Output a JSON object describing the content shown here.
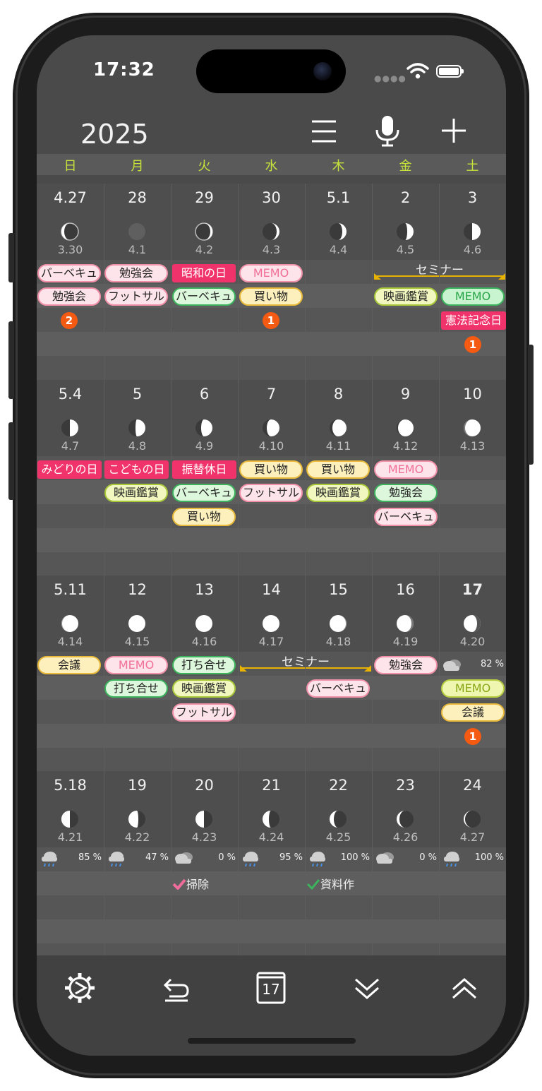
{
  "status": {
    "time": "17:32"
  },
  "header": {
    "year": "2025",
    "icons": [
      "menu-icon",
      "microphone-icon",
      "plus-icon"
    ]
  },
  "weekdays": [
    "日",
    "月",
    "火",
    "水",
    "木",
    "金",
    "土"
  ],
  "weeks": [
    {
      "dates": [
        "4.27",
        "28",
        "29",
        "30",
        "5.1",
        "2",
        "3"
      ],
      "lunar": [
        "3.30",
        "4.1",
        "4.2",
        "4.3",
        "4.4",
        "4.5",
        "4.6"
      ],
      "span": {
        "label": "セミナー"
      },
      "events": [
        [
          "バーベキュ",
          "勉強会"
        ],
        [
          "勉強会",
          "フットサル"
        ],
        [
          "昭和の日",
          "バーベキュ"
        ],
        [
          "MEMO",
          "買い物"
        ],
        [],
        [
          "映画鑑賞"
        ],
        [
          "MEMO",
          "憲法記念日"
        ]
      ],
      "badges": [
        "2",
        "",
        "",
        "1",
        "",
        "",
        "1"
      ]
    },
    {
      "dates": [
        "5.4",
        "5",
        "6",
        "7",
        "8",
        "9",
        "10"
      ],
      "lunar": [
        "4.7",
        "4.8",
        "4.9",
        "4.10",
        "4.11",
        "4.12",
        "4.13"
      ],
      "events": [
        [
          "みどりの日"
        ],
        [
          "こどもの日",
          "映画鑑賞"
        ],
        [
          "振替休日",
          "バーベキュ",
          "買い物"
        ],
        [
          "買い物",
          "フットサル"
        ],
        [
          "買い物",
          "映画鑑賞"
        ],
        [
          "MEMO",
          "勉強会",
          "バーベキュ"
        ],
        []
      ]
    },
    {
      "dates": [
        "5.11",
        "12",
        "13",
        "14",
        "15",
        "16",
        "17"
      ],
      "lunar": [
        "4.14",
        "4.15",
        "4.16",
        "4.17",
        "4.18",
        "4.19",
        "4.20"
      ],
      "span": {
        "label": "セミナー"
      },
      "events": [
        [
          "会議"
        ],
        [
          "MEMO",
          "打ち合せ"
        ],
        [
          "打ち合せ",
          "映画鑑賞",
          "フットサル"
        ],
        [],
        [
          "バーベキュ"
        ],
        [
          "勉強会"
        ],
        [
          "MEMO",
          "会議"
        ]
      ],
      "weather_today": "82 %",
      "badge_sat": "1"
    },
    {
      "dates": [
        "5.18",
        "19",
        "20",
        "21",
        "22",
        "23",
        "24"
      ],
      "lunar": [
        "4.21",
        "4.22",
        "4.23",
        "4.24",
        "4.25",
        "4.26",
        "4.27"
      ],
      "weather": [
        "85 %",
        "47 %",
        "0 %",
        "95 %",
        "100 %",
        "0 %",
        "100 %"
      ],
      "tasks": [
        "掃除",
        "資料作"
      ]
    }
  ],
  "tabbar": {
    "icons": [
      "settings-icon",
      "undo-icon",
      "today-icon",
      "scroll-down-icon",
      "scroll-up-icon"
    ],
    "today_number": "17"
  },
  "colors": {
    "holiday": "#f0336a",
    "badge": "#f55a12",
    "weekday_header": "#c6e33b",
    "span": "#e7b200"
  }
}
